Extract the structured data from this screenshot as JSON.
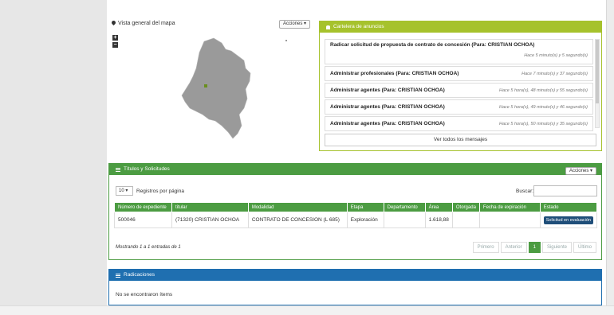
{
  "map": {
    "title": "Vista general del mapa",
    "actions": "Acciones ▾",
    "zoom_in": "+",
    "zoom_out": "−"
  },
  "messages": {
    "header": "Cartelera de anuncios",
    "items": [
      {
        "text": "Radicar solicitud de propuesta de contrato de concesión (Para: CRISTIAN OCHOA)",
        "time": "Hace 5 minuto(s) y 5 segundo(s)"
      },
      {
        "text": "Administrar profesionales (Para: CRISTIAN OCHOA)",
        "time": "Hace 7 minuto(s) y 37 segundo(s)"
      },
      {
        "text": "Administrar agentes (Para: CRISTIAN OCHOA)",
        "time": "Hace 5 hora(s), 48 minuto(s) y 55 segundo(s)"
      },
      {
        "text": "Administrar agentes (Para: CRISTIAN OCHOA)",
        "time": "Hace 5 hora(s), 49 minuto(s) y 46 segundo(s)"
      },
      {
        "text": "Administrar agentes (Para: CRISTIAN OCHOA)",
        "time": "Hace 5 hora(s), 50 minuto(s) y 35 segundo(s)"
      }
    ],
    "see_all": "Ver todos los mensajes"
  },
  "titles": {
    "header": "Títulos y Solicitudes",
    "actions": "Acciones ▾",
    "per_page_value": "10",
    "per_page_label": "Registros por página",
    "search_label": "Buscar:",
    "columns": [
      "Número de expediente",
      "titular",
      "Modalidad",
      "Etapa",
      "Departamento",
      "Área",
      "Otorgada",
      "Fecha de expiración",
      "Estado"
    ],
    "rows": [
      {
        "expediente": "500046",
        "titular": "(71320) CRISTIAN OCHOA",
        "modalidad": "CONTRATO DE CONCESION (L 685)",
        "etapa": "Exploración",
        "departamento": "",
        "area": "1.618,88",
        "otorgada": "",
        "expiracion": "",
        "estado": "Solicitud en evaluación"
      }
    ],
    "showing": "Mostrando 1 a 1 entradas de 1",
    "pager": {
      "first": "Primero",
      "prev": "Anterior",
      "current": "1",
      "next": "Siguiente",
      "last": "Último"
    }
  },
  "radicaciones": {
    "header": "Radicaciones",
    "empty": "No se encontraron ítems"
  }
}
